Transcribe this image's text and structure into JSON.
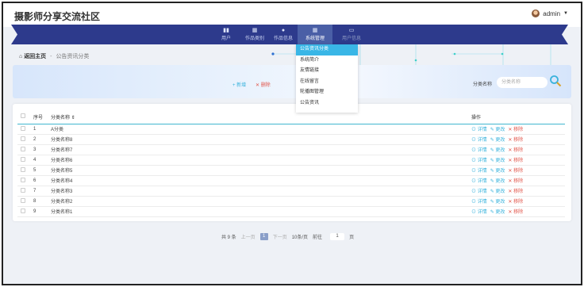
{
  "header": {
    "site_title": "摄影师分享交流社区",
    "user_name": "admin"
  },
  "nav": {
    "items": [
      {
        "label": "用户",
        "icon": "chart-bar-icon"
      },
      {
        "label": "作品类别",
        "icon": "grid-icon"
      },
      {
        "label": "作品信息",
        "icon": "person-icon"
      },
      {
        "label": "系统管理",
        "icon": "grid-icon",
        "active": true
      },
      {
        "label": "用户信息",
        "icon": "calendar-icon"
      }
    ]
  },
  "dropdown": {
    "items": [
      "公告资讯分类",
      "系统简介",
      "友情链接",
      "在线留言",
      "轮播图管理",
      "公告资讯"
    ]
  },
  "breadcrumb": {
    "home": "返回主页",
    "separator": "-",
    "current": "公告资讯分类"
  },
  "toolbar": {
    "add_label": "+ 新增",
    "delete_label": "✕ 删除",
    "search_label": "分类名称",
    "search_placeholder": "分类名称"
  },
  "table": {
    "headers": {
      "index": "序号",
      "name": "分类名称",
      "sort_icon": "⇕",
      "actions": "操作"
    },
    "actions": {
      "detail": "详情",
      "edit": "更改",
      "remove": "移除"
    },
    "rows": [
      {
        "index": "1",
        "name": "A分类"
      },
      {
        "index": "2",
        "name": "分类名称8"
      },
      {
        "index": "3",
        "name": "分类名称7"
      },
      {
        "index": "4",
        "name": "分类名称6"
      },
      {
        "index": "5",
        "name": "分类名称5"
      },
      {
        "index": "6",
        "name": "分类名称4"
      },
      {
        "index": "7",
        "name": "分类名称3"
      },
      {
        "index": "8",
        "name": "分类名称2"
      },
      {
        "index": "9",
        "name": "分类名称1"
      }
    ]
  },
  "pager": {
    "total": "共 9 条",
    "prev": "上一页",
    "current": "1",
    "next": "下一页",
    "page_size": "10条/页",
    "goto_label": "前往",
    "goto_value": "1",
    "page_unit": "页"
  },
  "colors": {
    "nav_bg": "#2d3a8c",
    "accent": "#39b6e6",
    "danger": "#e2564b"
  }
}
